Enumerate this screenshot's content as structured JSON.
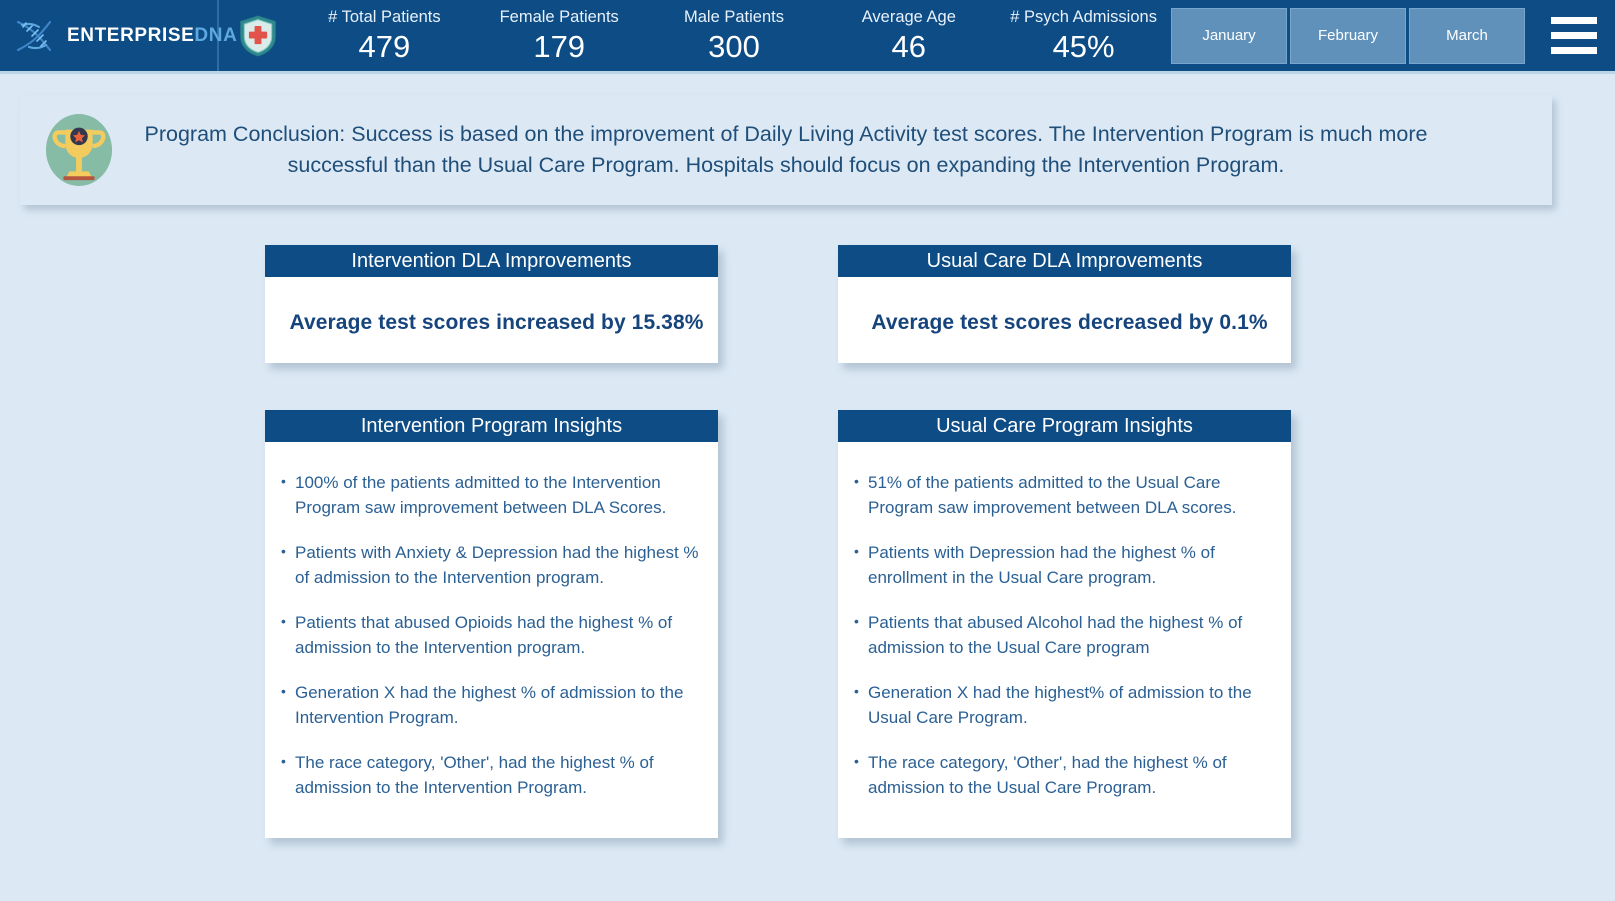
{
  "header": {
    "brand": {
      "enterprise": "ENTERPRISE",
      "dna": "DNA",
      "logo_icon": "dna-helix-icon"
    },
    "shield_icon": "medical-shield-icon",
    "kpis": [
      {
        "label": "# Total Patients",
        "value": "479"
      },
      {
        "label": "Female Patients",
        "value": "179"
      },
      {
        "label": "Male Patients",
        "value": "300"
      },
      {
        "label": "Average Age",
        "value": "46"
      },
      {
        "label": "# Psych Admissions",
        "value": "45%"
      }
    ],
    "months": [
      {
        "label": "January"
      },
      {
        "label": "February"
      },
      {
        "label": "March"
      }
    ],
    "menu_icon": "hamburger-menu-icon"
  },
  "banner": {
    "icon": "trophy-icon",
    "text": "Program Conclusion: Success is based on the improvement of Daily Living Activity test scores. The Intervention Program is much more successful than the Usual Care Program. Hospitals should focus on expanding the Intervention Program."
  },
  "cards": {
    "intervention_dla": {
      "title": "Intervention DLA Improvements",
      "score_text": "Average test scores increased by 15.38%"
    },
    "usual_care_dla": {
      "title": "Usual Care DLA Improvements",
      "score_text": "Average test scores decreased by 0.1%"
    },
    "intervention_insights": {
      "title": "Intervention Program Insights",
      "bullets": [
        "100% of the patients admitted to the Intervention Program saw improvement between DLA Scores.",
        "Patients with Anxiety & Depression had the highest % of admission to the Intervention program.",
        "Patients that abused Opioids had the highest % of admission to the Intervention program.",
        "Generation X had the highest % of admission to the Intervention Program.",
        "The race category, 'Other', had the highest % of admission to the Intervention Program."
      ]
    },
    "usual_care_insights": {
      "title": "Usual Care Program Insights",
      "bullets": [
        "51% of the patients admitted to the Usual Care Program saw improvement between DLA scores.",
        "Patients with Depression had the highest % of enrollment in the Usual Care program.",
        "Patients that abused Alcohol had the highest % of admission to the Usual Care program",
        "Generation X had the highest% of admission to the Usual Care Program.",
        "The race category, 'Other', had the highest % of admission to the Usual Care Program."
      ]
    }
  },
  "colors": {
    "header_blue": "#0d4c85",
    "page_background": "#dce9f5",
    "month_button": "#5f91bb",
    "text_blue": "#1f4e79",
    "bullet_blue": "#2b6094"
  }
}
